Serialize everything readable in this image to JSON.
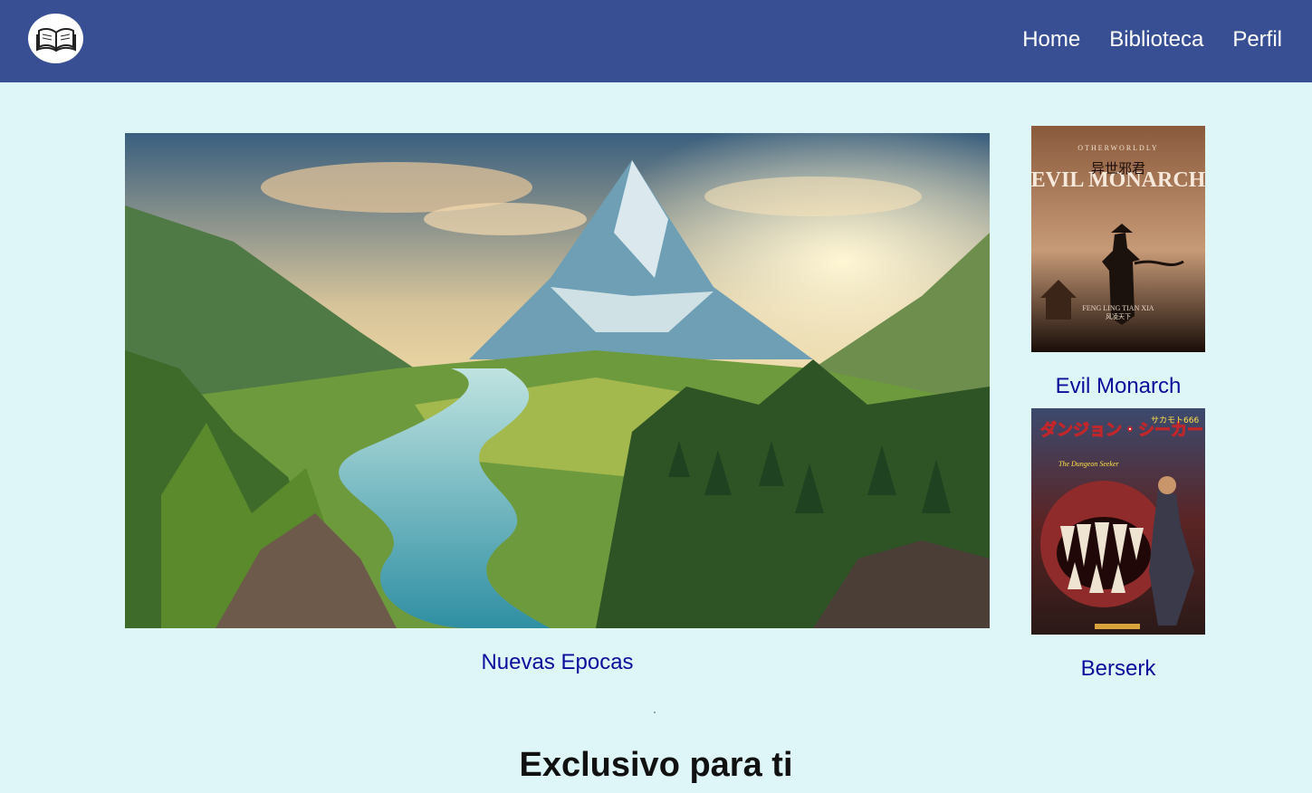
{
  "nav": {
    "logo_icon": "open-book-icon",
    "links": [
      "Home",
      "Biblioteca",
      "Perfil"
    ]
  },
  "featured": {
    "title": "Nuevas Epocas"
  },
  "side_books": [
    {
      "title": "Evil Monarch",
      "cover_text_top": "OTHERWORLDLY",
      "cover_text_main": "EVIL MONARCH",
      "cover_text_cjk": "异世邪君",
      "cover_author": "FENG LING TIAN XIA",
      "cover_author_cjk": "风凌天下"
    },
    {
      "title": "Berserk",
      "cover_text_main": "ダンジョン・シーカー",
      "cover_text_sub": "The Dungeon Seeker",
      "cover_author": "サカモト666"
    }
  ],
  "section": {
    "heading": "Exclusivo para ti"
  },
  "colors": {
    "navbar": "#384f94",
    "background": "#def6f8",
    "link": "#0d0d9b"
  }
}
